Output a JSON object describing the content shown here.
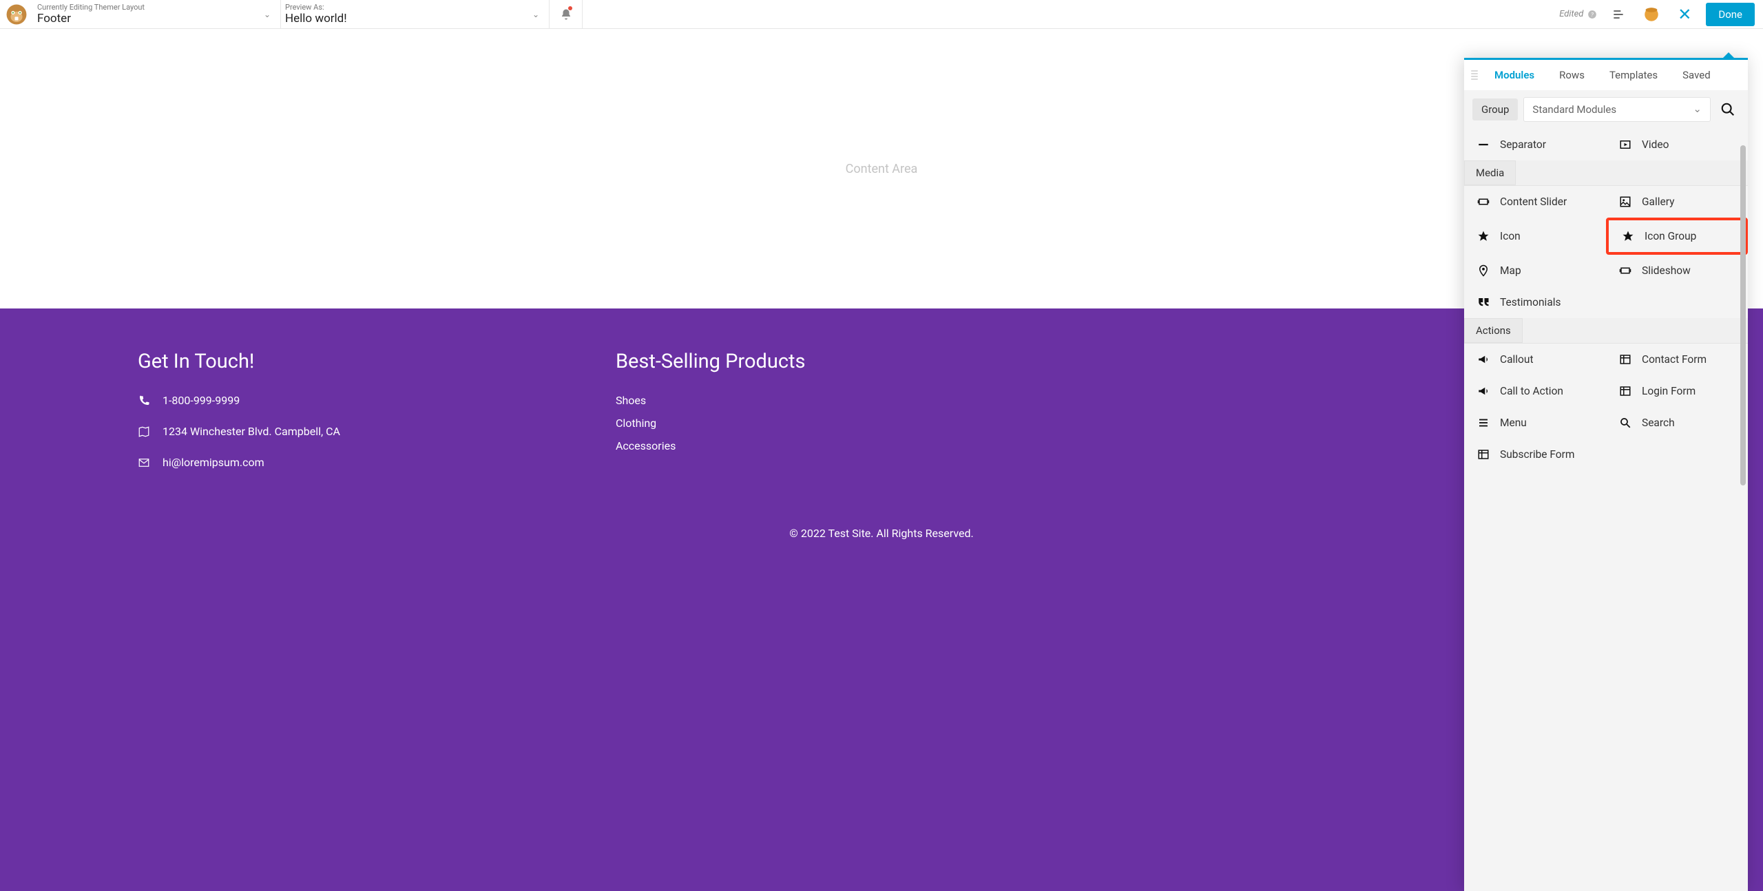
{
  "topbar": {
    "editing_label": "Currently Editing Themer Layout",
    "editing_value": "Footer",
    "preview_label": "Preview As:",
    "preview_value": "Hello world!",
    "edited_label": "Edited",
    "done_label": "Done"
  },
  "canvas": {
    "content_area_label": "Content Area"
  },
  "footer": {
    "col1_title": "Get In Touch!",
    "phone": "1-800-999-9999",
    "address": "1234 Winchester Blvd. Campbell, CA",
    "email": "hi@loremipsum.com",
    "col2_title": "Best-Selling Products",
    "products": [
      "Shoes",
      "Clothing",
      "Accessories"
    ],
    "copyright": "© 2022 Test Site. All Rights Reserved."
  },
  "drawer": {
    "tabs": [
      "Modules",
      "Rows",
      "Templates",
      "Saved"
    ],
    "group_chip": "Group",
    "group_select": "Standard Modules",
    "basic_row": {
      "separator": "Separator",
      "video": "Video"
    },
    "section_media": "Media",
    "media": {
      "content_slider": "Content Slider",
      "gallery": "Gallery",
      "icon": "Icon",
      "icon_group": "Icon Group",
      "map": "Map",
      "slideshow": "Slideshow",
      "testimonials": "Testimonials"
    },
    "section_actions": "Actions",
    "actions": {
      "callout": "Callout",
      "contact_form": "Contact Form",
      "call_to_action": "Call to Action",
      "login_form": "Login Form",
      "menu": "Menu",
      "search": "Search",
      "subscribe_form": "Subscribe Form"
    }
  }
}
